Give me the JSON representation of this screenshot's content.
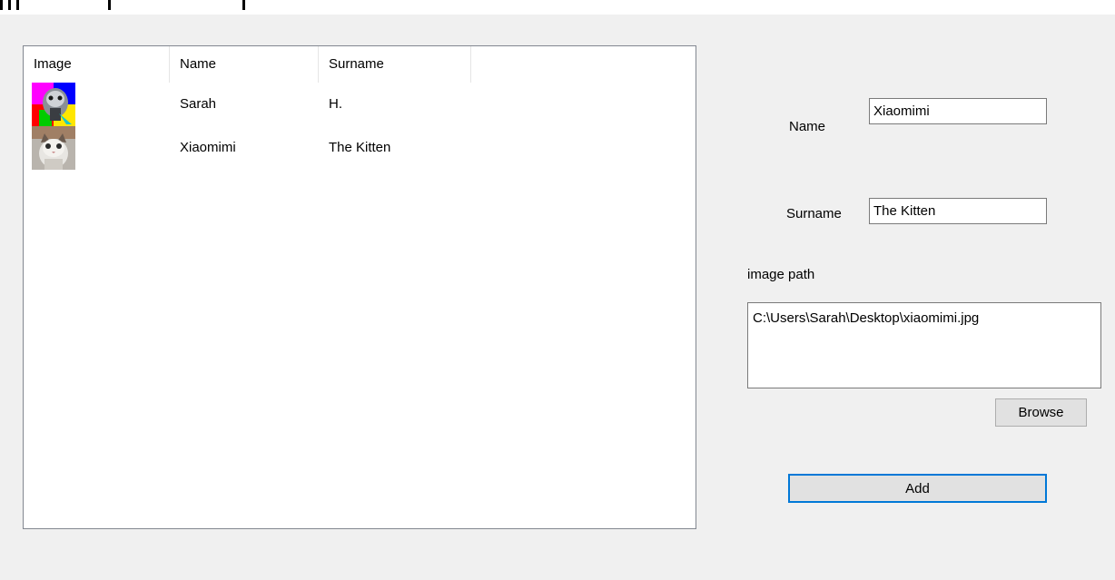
{
  "listview": {
    "columns": [
      "Image",
      "Name",
      "Surname"
    ],
    "rows": [
      {
        "image": "sarah-avatar-icon",
        "name": "Sarah",
        "surname": "H."
      },
      {
        "image": "kitten-avatar-icon",
        "name": "Xiaomimi",
        "surname": "The Kitten"
      }
    ]
  },
  "form": {
    "name_label": "Name",
    "name_value": "Xiaomimi",
    "surname_label": "Surname",
    "surname_value": "The Kitten",
    "image_path_label": "image path",
    "image_path_value": "C:\\Users\\Sarah\\Desktop\\xiaomimi.jpg",
    "browse_label": "Browse",
    "add_label": "Add"
  },
  "colors": {
    "window_bg": "#f0f0f0",
    "accent_focus": "#0078d7"
  }
}
